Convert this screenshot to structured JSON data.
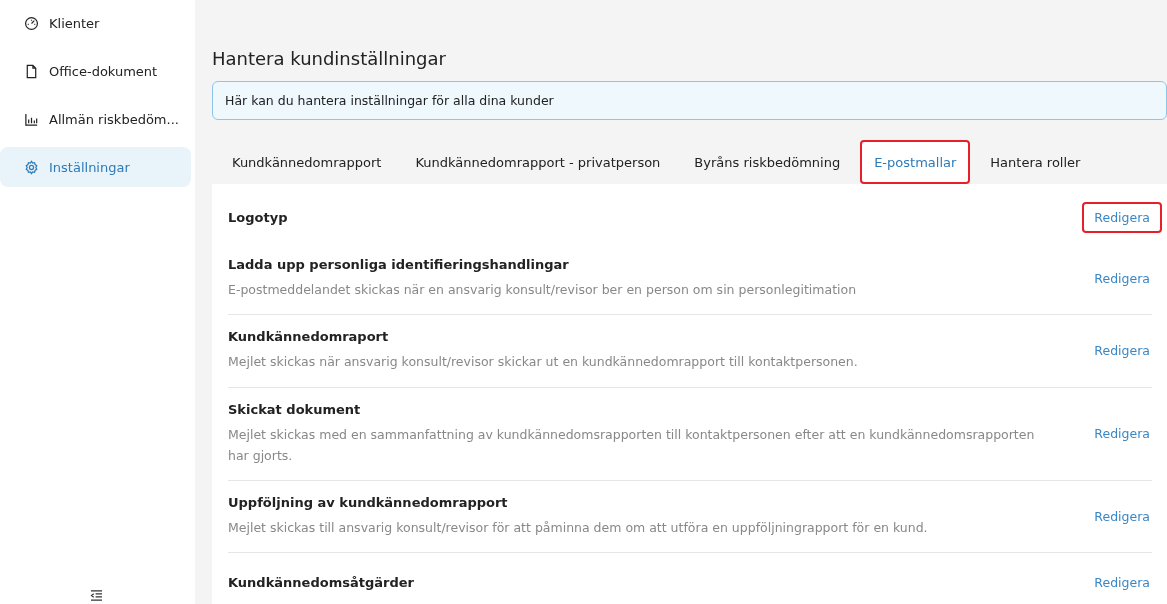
{
  "sidebar": {
    "items": [
      {
        "label": "Klienter",
        "kind": "gauge",
        "selected": false
      },
      {
        "label": "Office-dokument",
        "kind": "file",
        "selected": false
      },
      {
        "label": "Allmän riskbedöm...",
        "kind": "chart",
        "selected": false
      },
      {
        "label": "Inställningar",
        "kind": "gear",
        "selected": true
      }
    ]
  },
  "page": {
    "title": "Hantera kundinställningar",
    "info": "Här kan du hantera inställningar för alla dina kunder"
  },
  "tabs": [
    {
      "label": "Kundkännedomrapport",
      "selected": false,
      "highlighted": false
    },
    {
      "label": "Kundkännedomrapport - privatperson",
      "selected": false,
      "highlighted": false
    },
    {
      "label": "Byråns riskbedömning",
      "selected": false,
      "highlighted": false
    },
    {
      "label": "E-postmallar",
      "selected": true,
      "highlighted": true
    },
    {
      "label": "Hantera roller",
      "selected": false,
      "highlighted": false
    }
  ],
  "templates": [
    {
      "title": "Logotyp",
      "action": "Redigera",
      "highlighted": true
    },
    {
      "title": "Ladda upp personliga identifieringshandlingar",
      "description": "E-postmeddelandet skickas när en ansvarig konsult/revisor ber en person om sin personlegitimation",
      "action": "Redigera",
      "highlighted": false
    },
    {
      "title": "Kundkännedomraport",
      "description": "Mejlet skickas när ansvarig konsult/revisor skickar ut en kundkännedomrapport till kontaktpersonen.",
      "action": "Redigera",
      "highlighted": false
    },
    {
      "title": "Skickat dokument",
      "description": "Mejlet skickas med en sammanfattning av kundkännedomsrapporten till kontaktpersonen efter att en kundkännedomsrapporten har gjorts.",
      "action": "Redigera",
      "highlighted": false
    },
    {
      "title": "Uppföljning av kundkännedomrapport",
      "description": "Mejlet skickas till ansvarig konsult/revisor för att påminna dem om att utföra en uppföljningrapport för en kund.",
      "action": "Redigera",
      "highlighted": false
    },
    {
      "title": "Kundkännedomsåtgärder",
      "action": "Redigera",
      "highlighted": false
    }
  ]
}
